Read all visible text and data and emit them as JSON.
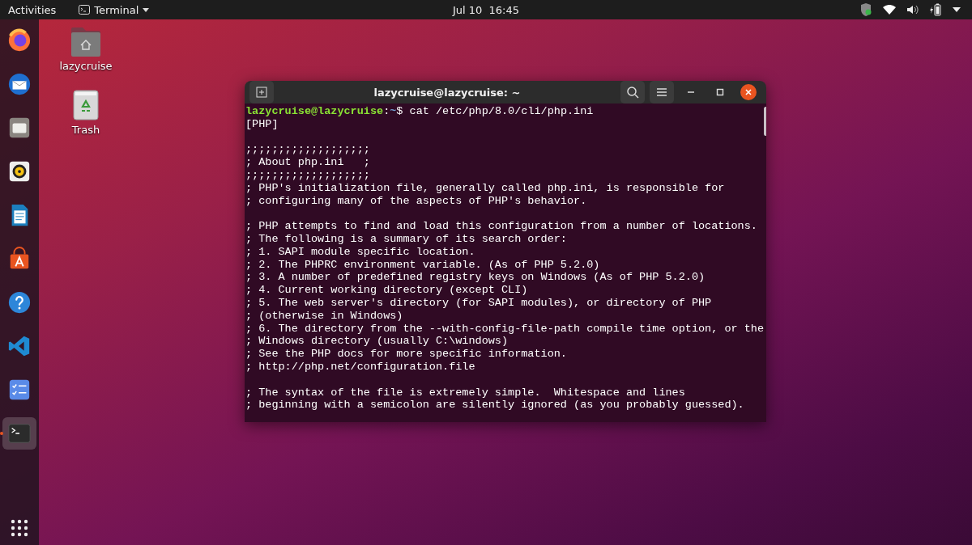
{
  "top_bar": {
    "activities": "Activities",
    "app_menu": "Terminal",
    "clock": "Jul 10  16:45"
  },
  "dock": {
    "apps": [
      {
        "kind": "firefox",
        "running": false,
        "selected": false
      },
      {
        "kind": "thunderbird",
        "running": false,
        "selected": false
      },
      {
        "kind": "files",
        "running": false,
        "selected": false
      },
      {
        "kind": "rhythmbox",
        "running": false,
        "selected": false
      },
      {
        "kind": "writer",
        "running": false,
        "selected": false
      },
      {
        "kind": "software",
        "running": false,
        "selected": false
      },
      {
        "kind": "help",
        "running": false,
        "selected": false
      },
      {
        "kind": "vscode",
        "running": false,
        "selected": false
      },
      {
        "kind": "tasks",
        "running": false,
        "selected": false
      },
      {
        "kind": "terminal",
        "running": true,
        "selected": true
      }
    ]
  },
  "desktop_icons": [
    {
      "kind": "home",
      "label": "lazycruise"
    },
    {
      "kind": "trash",
      "label": "Trash"
    }
  ],
  "terminal": {
    "title": "lazycruise@lazycruise: ~",
    "prompt": {
      "user_host": "lazycruise@lazycruise",
      "separator": ":",
      "path": "~",
      "symbol": "$",
      "command": " cat /etc/php/8.0/cli/php.ini"
    },
    "output": [
      [
        "[PHP]"
      ],
      [
        ";;;;;;;;;;;;;;;;;;;",
        "; About php.ini   ;",
        ";;;;;;;;;;;;;;;;;;;",
        "; PHP's initialization file, generally called php.ini, is responsible for",
        "; configuring many of the aspects of PHP's behavior."
      ],
      [
        "; PHP attempts to find and load this configuration from a number of locations.",
        "; The following is a summary of its search order:",
        "; 1. SAPI module specific location.",
        "; 2. The PHPRC environment variable. (As of PHP 5.2.0)",
        "; 3. A number of predefined registry keys on Windows (As of PHP 5.2.0)",
        "; 4. Current working directory (except CLI)",
        "; 5. The web server's directory (for SAPI modules), or directory of PHP",
        "; (otherwise in Windows)",
        "; 6. The directory from the --with-config-file-path compile time option, or the",
        "; Windows directory (usually C:\\windows)",
        "; See the PHP docs for more specific information.",
        "; http://php.net/configuration.file"
      ],
      [
        "; The syntax of the file is extremely simple.  Whitespace and lines",
        "; beginning with a semicolon are silently ignored (as you probably guessed)."
      ]
    ]
  }
}
